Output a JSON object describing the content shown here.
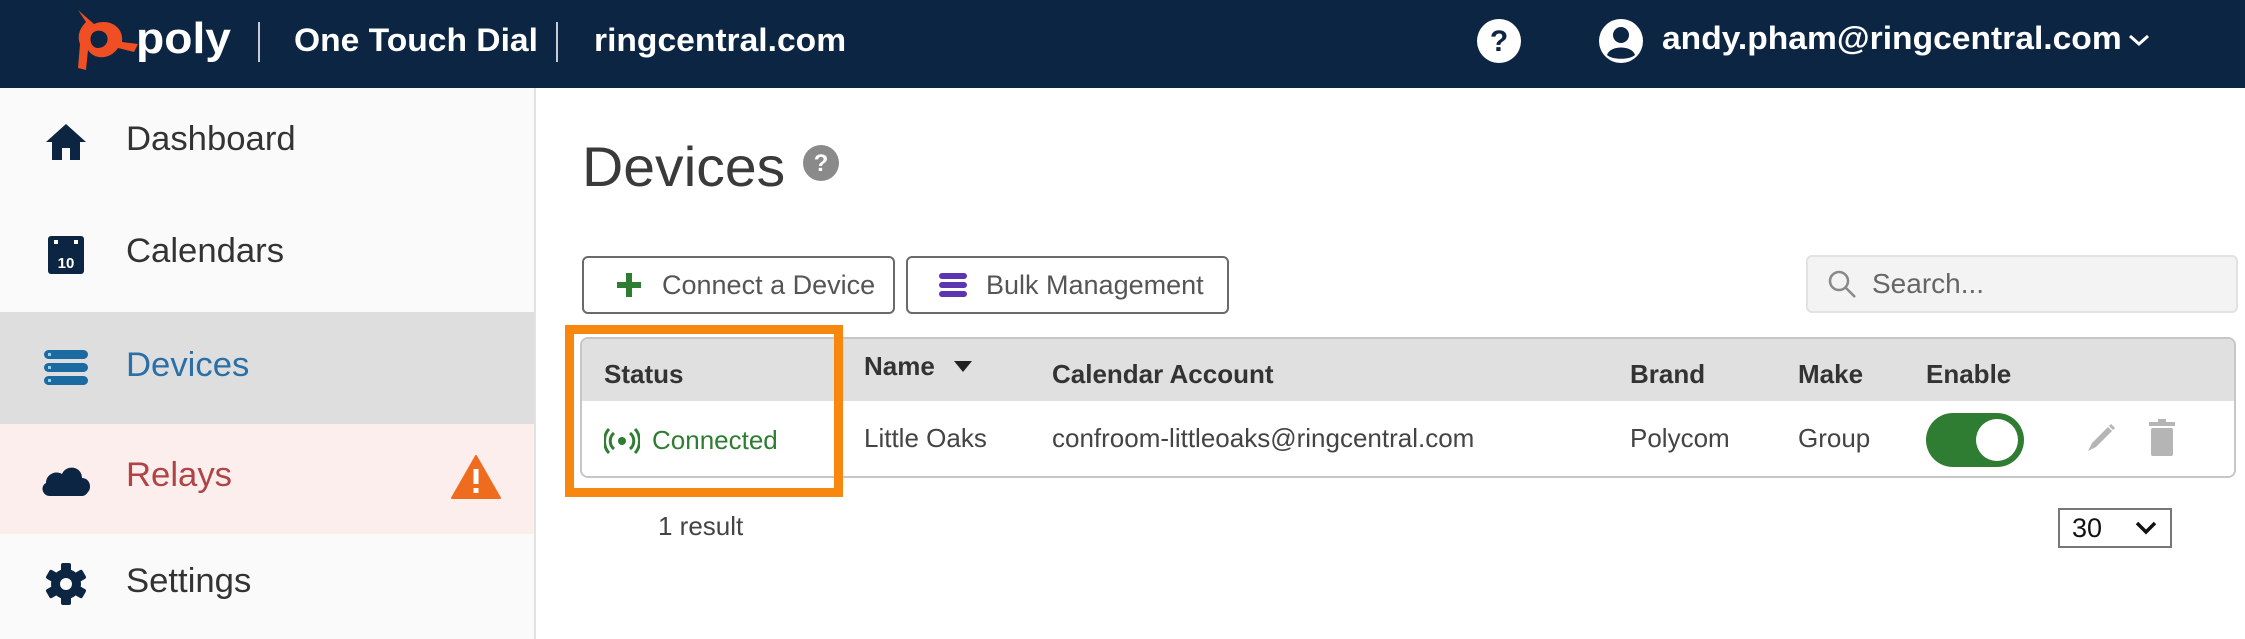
{
  "header": {
    "brand": "poly",
    "app_name": "One Touch Dial",
    "domain": "ringcentral.com",
    "help_icon": "question-circle-icon",
    "user_icon": "user-circle-icon",
    "user_email": "andy.pham@ringcentral.com",
    "user_menu_icon": "chevron-down-icon"
  },
  "sidebar": {
    "items": [
      {
        "label": "Dashboard",
        "icon": "home-icon",
        "state": "default"
      },
      {
        "label": "Calendars",
        "icon": "calendar-icon",
        "calendar_day": "10",
        "state": "default"
      },
      {
        "label": "Devices",
        "icon": "list-icon",
        "state": "selected"
      },
      {
        "label": "Relays",
        "icon": "cloud-icon",
        "state": "alert",
        "badge_icon": "warning-icon"
      },
      {
        "label": "Settings",
        "icon": "gear-icon",
        "state": "default"
      }
    ]
  },
  "main": {
    "title": "Devices",
    "title_help_icon": "question-circle-icon",
    "buttons": {
      "connect": "Connect a Device",
      "bulk": "Bulk Management"
    },
    "search": {
      "placeholder": "Search...",
      "value": ""
    },
    "table": {
      "columns": [
        "Status",
        "Name",
        "Calendar Account",
        "Brand",
        "Make",
        "Enable"
      ],
      "sorted_column": "Name",
      "sort_direction": "descending",
      "rows": [
        {
          "status": "Connected",
          "name": "Little Oaks",
          "calendar_account": "confroom-littleoaks@ringcentral.com",
          "brand": "Polycom",
          "make": "Group",
          "enabled": true
        }
      ]
    },
    "result_count": "1 result",
    "page_size": "30"
  },
  "colors": {
    "header_bg": "#0b2542",
    "brand_orange": "#f04e23",
    "selected_nav_text": "#2a6fa6",
    "alert_nav_text": "#b04445",
    "alert_nav_bg": "#fdeeee",
    "warning": "#ef6c1f",
    "connected_green": "#2e7d32",
    "bulk_purple": "#5e35b1",
    "highlight_orange": "#f7870f"
  }
}
